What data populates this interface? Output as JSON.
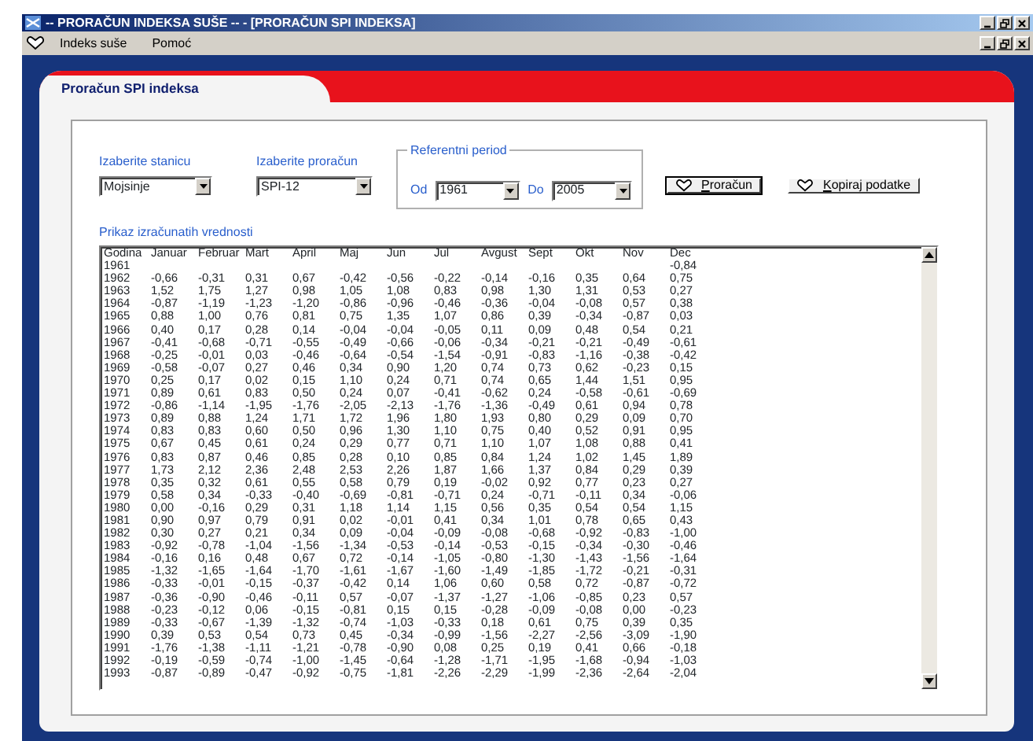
{
  "window": {
    "title": "-- PRORAČUN INDEKSA SUŠE --  - [PRORAČUN SPI INDEKSA]"
  },
  "menu": [
    {
      "label": "Indeks suše"
    },
    {
      "label": "Pomoć"
    }
  ],
  "panel": {
    "title": "Proračun SPI indeksa"
  },
  "station": {
    "label": "Izaberite stanicu",
    "value": "Mojsinje"
  },
  "calculation": {
    "label": "Izaberite proračun",
    "value": "SPI-12"
  },
  "reference_period": {
    "legend": "Referentni period",
    "from_label": "Od",
    "from_value": "1961",
    "to_label": "Do",
    "to_value": "2005"
  },
  "buttons": [
    {
      "label": "Proračun",
      "default": true
    },
    {
      "label": "Kopiraj podatke",
      "default": false
    }
  ],
  "results": {
    "caption": "Prikaz izračunatih vrednosti",
    "columns": [
      "Godina",
      "Januar",
      "Februar",
      "Mart",
      "April",
      "Maj",
      "Jun",
      "Jul",
      "Avgust",
      "Sept",
      "Okt",
      "Nov",
      "Dec"
    ],
    "rows": [
      {
        "year": "1961",
        "values": [
          "-0,84"
        ]
      },
      {
        "year": "1962",
        "values": [
          "-0,66",
          "-0,31",
          "0,31",
          "0,67",
          "-0,42",
          "-0,56",
          "-0,22",
          "-0,14",
          "-0,16",
          "0,35",
          "0,64",
          "0,75"
        ]
      },
      {
        "year": "1963",
        "values": [
          "1,52",
          "1,75",
          "1,27",
          "0,98",
          "1,05",
          "1,08",
          "0,83",
          "0,98",
          "1,30",
          "1,31",
          "0,53",
          "0,27"
        ]
      },
      {
        "year": "1964",
        "values": [
          "-0,87",
          "-1,19",
          "-1,23",
          "-1,20",
          "-0,86",
          "-0,96",
          "-0,46",
          "-0,36",
          "-0,04",
          "-0,08",
          "0,57",
          "0,38"
        ]
      },
      {
        "year": "1965",
        "values": [
          "0,88",
          "1,00",
          "0,76",
          "0,81",
          "0,75",
          "1,35",
          "1,07",
          "0,86",
          "0,39",
          "-0,34",
          "-0,87",
          "0,03"
        ]
      },
      {
        "year": "1966",
        "values": [
          "0,40",
          "0,17",
          "0,28",
          "0,14",
          "-0,04",
          "-0,04",
          "-0,05",
          "0,11",
          "0,09",
          "0,48",
          "0,54",
          "0,21"
        ]
      },
      {
        "year": "1967",
        "values": [
          "-0,41",
          "-0,68",
          "-0,71",
          "-0,55",
          "-0,49",
          "-0,66",
          "-0,06",
          "-0,34",
          "-0,21",
          "-0,21",
          "-0,49",
          "-0,61"
        ]
      },
      {
        "year": "1968",
        "values": [
          "-0,25",
          "-0,01",
          "0,03",
          "-0,46",
          "-0,64",
          "-0,54",
          "-1,54",
          "-0,91",
          "-0,83",
          "-1,16",
          "-0,38",
          "-0,42"
        ]
      },
      {
        "year": "1969",
        "values": [
          "-0,58",
          "-0,07",
          "0,27",
          "0,46",
          "0,34",
          "0,90",
          "1,20",
          "0,74",
          "0,73",
          "0,62",
          "-0,23",
          "0,15"
        ]
      },
      {
        "year": "1970",
        "values": [
          "0,25",
          "0,17",
          "0,02",
          "0,15",
          "1,10",
          "0,24",
          "0,71",
          "0,74",
          "0,65",
          "1,44",
          "1,51",
          "0,95"
        ]
      },
      {
        "year": "1971",
        "values": [
          "0,89",
          "0,61",
          "0,83",
          "0,50",
          "0,24",
          "0,07",
          "-0,41",
          "-0,62",
          "0,24",
          "-0,58",
          "-0,61",
          "-0,69"
        ]
      },
      {
        "year": "1972",
        "values": [
          "-0,86",
          "-1,14",
          "-1,95",
          "-1,76",
          "-2,05",
          "-2,13",
          "-1,76",
          "-1,36",
          "-0,49",
          "0,61",
          "0,94",
          "0,78"
        ]
      },
      {
        "year": "1973",
        "values": [
          "0,89",
          "0,88",
          "1,24",
          "1,71",
          "1,72",
          "1,96",
          "1,80",
          "1,93",
          "0,80",
          "0,29",
          "0,09",
          "0,70"
        ]
      },
      {
        "year": "1974",
        "values": [
          "0,83",
          "0,83",
          "0,60",
          "0,50",
          "0,96",
          "1,30",
          "1,10",
          "0,75",
          "0,40",
          "0,52",
          "0,91",
          "0,95"
        ]
      },
      {
        "year": "1975",
        "values": [
          "0,67",
          "0,45",
          "0,61",
          "0,24",
          "0,29",
          "0,77",
          "0,71",
          "1,10",
          "1,07",
          "1,08",
          "0,88",
          "0,41"
        ]
      },
      {
        "year": "1976",
        "values": [
          "0,83",
          "0,87",
          "0,46",
          "0,85",
          "0,28",
          "0,10",
          "0,85",
          "0,84",
          "1,24",
          "1,02",
          "1,45",
          "1,89"
        ]
      },
      {
        "year": "1977",
        "values": [
          "1,73",
          "2,12",
          "2,36",
          "2,48",
          "2,53",
          "2,26",
          "1,87",
          "1,66",
          "1,37",
          "0,84",
          "0,29",
          "0,39"
        ]
      },
      {
        "year": "1978",
        "values": [
          "0,35",
          "0,32",
          "0,61",
          "0,55",
          "0,58",
          "0,79",
          "0,19",
          "-0,02",
          "0,92",
          "0,77",
          "0,23",
          "0,27"
        ]
      },
      {
        "year": "1979",
        "values": [
          "0,58",
          "0,34",
          "-0,33",
          "-0,40",
          "-0,69",
          "-0,81",
          "-0,71",
          "0,24",
          "-0,71",
          "-0,11",
          "0,34",
          "-0,06"
        ]
      },
      {
        "year": "1980",
        "values": [
          "0,00",
          "-0,16",
          "0,29",
          "0,31",
          "1,18",
          "1,14",
          "1,15",
          "0,56",
          "0,35",
          "0,54",
          "0,54",
          "1,15"
        ]
      },
      {
        "year": "1981",
        "values": [
          "0,90",
          "0,97",
          "0,79",
          "0,91",
          "0,02",
          "-0,01",
          "0,41",
          "0,34",
          "1,01",
          "0,78",
          "0,65",
          "0,43"
        ]
      },
      {
        "year": "1982",
        "values": [
          "0,30",
          "0,27",
          "0,21",
          "0,34",
          "0,09",
          "-0,04",
          "-0,09",
          "-0,08",
          "-0,68",
          "-0,92",
          "-0,83",
          "-1,00"
        ]
      },
      {
        "year": "1983",
        "values": [
          "-0,92",
          "-0,78",
          "-1,04",
          "-1,56",
          "-1,34",
          "-0,53",
          "-0,14",
          "-0,53",
          "-0,15",
          "-0,34",
          "-0,30",
          "-0,46"
        ]
      },
      {
        "year": "1984",
        "values": [
          "-0,16",
          "0,16",
          "0,48",
          "0,67",
          "0,72",
          "-0,14",
          "-1,05",
          "-0,80",
          "-1,30",
          "-1,43",
          "-1,56",
          "-1,64"
        ]
      },
      {
        "year": "1985",
        "values": [
          "-1,32",
          "-1,65",
          "-1,64",
          "-1,70",
          "-1,61",
          "-1,67",
          "-1,60",
          "-1,49",
          "-1,85",
          "-1,72",
          "-0,21",
          "-0,31"
        ]
      },
      {
        "year": "1986",
        "values": [
          "-0,33",
          "-0,01",
          "-0,15",
          "-0,37",
          "-0,42",
          "0,14",
          "1,06",
          "0,60",
          "0,58",
          "0,72",
          "-0,87",
          "-0,72"
        ]
      },
      {
        "year": "1987",
        "values": [
          "-0,36",
          "-0,90",
          "-0,46",
          "-0,11",
          "0,57",
          "-0,07",
          "-1,37",
          "-1,27",
          "-1,06",
          "-0,85",
          "0,23",
          "0,57"
        ]
      },
      {
        "year": "1988",
        "values": [
          "-0,23",
          "-0,12",
          "0,06",
          "-0,15",
          "-0,81",
          "0,15",
          "0,15",
          "-0,28",
          "-0,09",
          "-0,08",
          "0,00",
          "-0,23"
        ]
      },
      {
        "year": "1989",
        "values": [
          "-0,33",
          "-0,67",
          "-1,39",
          "-1,32",
          "-0,74",
          "-1,03",
          "-0,33",
          "0,18",
          "0,61",
          "0,75",
          "0,39",
          "0,35"
        ]
      },
      {
        "year": "1990",
        "values": [
          "0,39",
          "0,53",
          "0,54",
          "0,73",
          "0,45",
          "-0,34",
          "-0,99",
          "-1,56",
          "-2,27",
          "-2,56",
          "-3,09",
          "-1,90"
        ]
      },
      {
        "year": "1991",
        "values": [
          "-1,76",
          "-1,38",
          "-1,11",
          "-1,21",
          "-0,78",
          "-0,90",
          "0,08",
          "0,25",
          "0,19",
          "0,41",
          "0,66",
          "-0,18"
        ]
      },
      {
        "year": "1992",
        "values": [
          "-0,19",
          "-0,59",
          "-0,74",
          "-1,00",
          "-1,45",
          "-0,64",
          "-1,28",
          "-1,71",
          "-1,95",
          "-1,68",
          "-0,94",
          "-1,03"
        ]
      },
      {
        "year": "1993",
        "values": [
          "-0,87",
          "-0,89",
          "-0,47",
          "-0,92",
          "-0,75",
          "-1,81",
          "-2,26",
          "-2,29",
          "-1,99",
          "-2,36",
          "-2,64",
          "-2,04"
        ]
      }
    ]
  }
}
